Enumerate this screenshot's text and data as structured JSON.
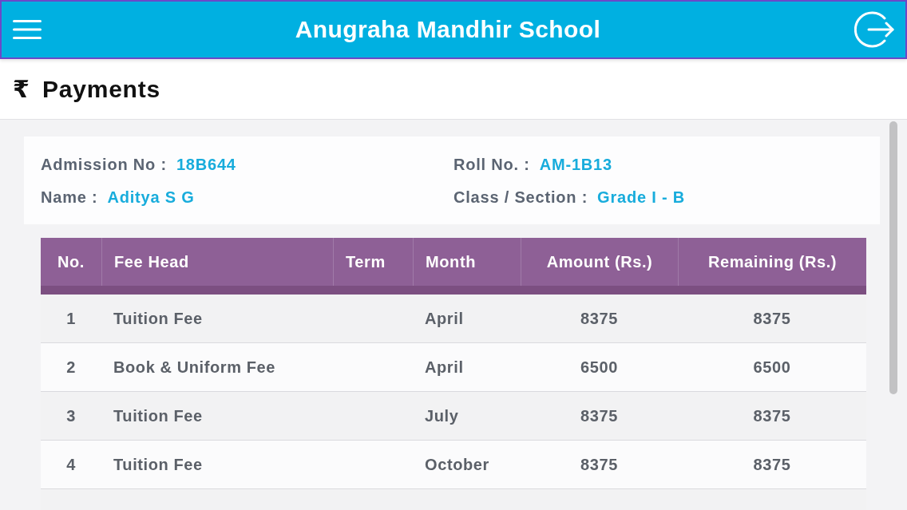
{
  "header": {
    "title": "Anugraha Mandhir School"
  },
  "page": {
    "currency_symbol": "₹",
    "title": "Payments"
  },
  "student": [
    {
      "label": "Admission No :",
      "value": "18B644"
    },
    {
      "label": "Roll No. :",
      "value": "AM-1B13"
    },
    {
      "label": "Name :",
      "value": "Aditya S G"
    },
    {
      "label": "Class / Section :",
      "value": "Grade I - B"
    }
  ],
  "table": {
    "columns": [
      "No.",
      "Fee Head",
      "Term",
      "Month",
      "Amount (Rs.)",
      "Remaining (Rs.)"
    ],
    "rows": [
      {
        "no": "1",
        "fee_head": "Tuition Fee",
        "month": "April",
        "amount": "8375",
        "remaining": "8375"
      },
      {
        "no": "2",
        "fee_head": "Book & Uniform Fee",
        "month": "April",
        "amount": "6500",
        "remaining": "6500"
      },
      {
        "no": "3",
        "fee_head": "Tuition Fee",
        "month": "July",
        "amount": "8375",
        "remaining": "8375"
      },
      {
        "no": "4",
        "fee_head": "Tuition Fee",
        "month": "October",
        "amount": "8375",
        "remaining": "8375"
      }
    ]
  }
}
